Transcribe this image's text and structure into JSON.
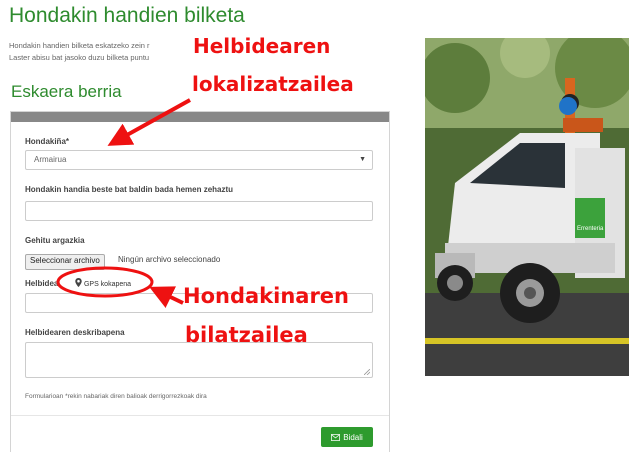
{
  "page": {
    "title": "Hondakin handien bilketa",
    "intro_line1": "Hondakin handien bilketa eskatzeko zein r",
    "intro_line2": "Laster abisu bat jasoko duzu bilketa puntu",
    "subtitle": "Eskaera berria"
  },
  "form": {
    "waste_label": "Hondakiña*",
    "waste_selected": "Armairua",
    "other_label": "Hondakin handia beste bat baldin bada hemen zehaztu",
    "photo_label": "Gehitu argazkia",
    "file_button": "Seleccionar archivo",
    "file_status": "Ningún archivo seleccionado",
    "address_label": "Helbidea",
    "gps_button": "GPS kokapena",
    "description_label": "Helbidearen deskribapena",
    "required_note": "Formularioan *rekin nabariak diren balioak derrigorrezkoak dira",
    "submit": "Bidali"
  },
  "annotations": {
    "top_line1": "Helbidearen",
    "top_line2": "lokalizatzailea",
    "bottom_line1": "Hondakinaren",
    "bottom_line2": "bilatzailea",
    "color": "#ee1111"
  },
  "photo": {
    "badge_text": "Errenteria"
  },
  "colors": {
    "brand_green": "#2e8b2e",
    "button_green": "#2e9b2e"
  }
}
